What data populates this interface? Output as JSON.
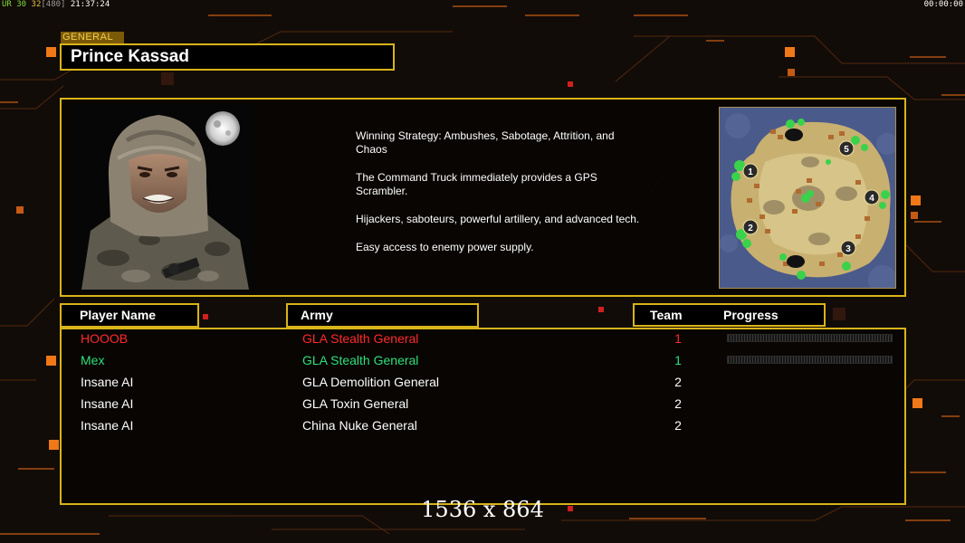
{
  "hud": {
    "fps_label": "UR",
    "fps_a": "30",
    "fps_b": "32",
    "bracket_value": "[480]",
    "clock": "21:37:24",
    "timer": "00:00:00"
  },
  "general": {
    "tag": "GENERAL",
    "name": "Prince Kassad",
    "strategy": [
      "Winning Strategy: Ambushes, Sabotage, Attrition, and Chaos",
      "The Command Truck immediately provides a GPS Scrambler.",
      "Hijackers, saboteurs, powerful artillery, and advanced tech.",
      "Easy access to enemy power supply."
    ]
  },
  "map": {
    "start_positions": [
      "1",
      "2",
      "3",
      "4",
      "5"
    ]
  },
  "table": {
    "headers": {
      "player": "Player Name",
      "army": "Army",
      "team": "Team",
      "progress": "Progress"
    },
    "rows": [
      {
        "name": "HOOOB",
        "army": "GLA Stealth General",
        "team": "1",
        "color": "#ff2a2a",
        "has_progress": true,
        "progress": 0
      },
      {
        "name": "Mex",
        "army": "GLA Stealth General",
        "team": "1",
        "color": "#2ee07a",
        "has_progress": true,
        "progress": 0
      },
      {
        "name": "Insane AI",
        "army": "GLA Demolition General",
        "team": "2",
        "color": "#ffffff",
        "has_progress": false
      },
      {
        "name": "Insane AI",
        "army": "GLA Toxin General",
        "team": "2",
        "color": "#ffffff",
        "has_progress": false
      },
      {
        "name": "Insane AI",
        "army": "China Nuke General",
        "team": "2",
        "color": "#ffffff",
        "has_progress": false
      }
    ]
  },
  "overlay": {
    "resolution": "1536 x 864"
  },
  "colors": {
    "frame_gold": "#d8b41a",
    "accent_orange": "#f07818",
    "background": "#120c08"
  }
}
